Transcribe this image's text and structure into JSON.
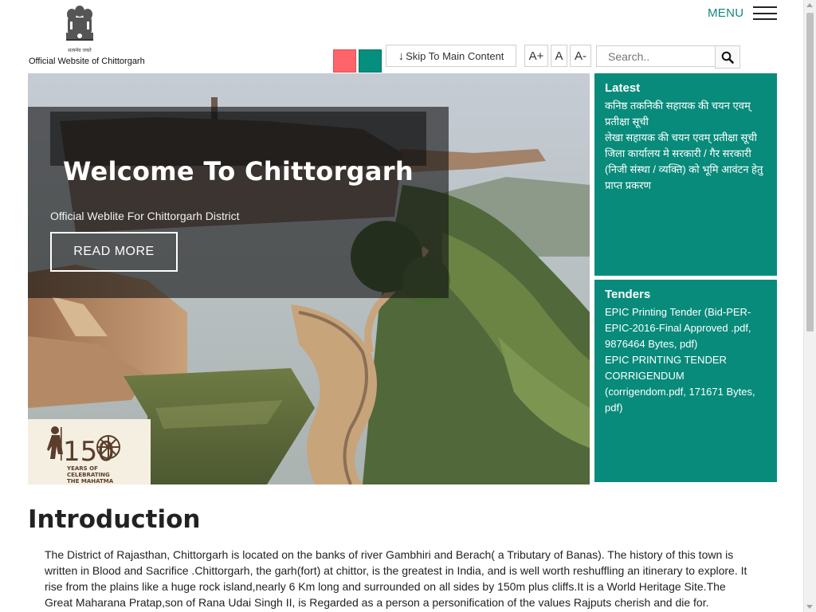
{
  "header": {
    "site_title": "Official Website of Chittorgarh",
    "emblem_caption": "सत्यमेव जयते",
    "menu_label": "MENU",
    "skip_link": "Skip To Main Content",
    "font_increase": "A+",
    "font_normal": "A",
    "font_decrease": "A-",
    "search_placeholder": "Search..",
    "theme_colors": [
      "#fd656a",
      "#058f7e"
    ]
  },
  "hero": {
    "title": "Welcome To Chittorgarh",
    "subtitle": "Official Weblite For Chittorgarh District",
    "button": "READ MORE",
    "badge_number": "150",
    "badge_line1": "YEARS OF",
    "badge_line2": "CELEBRATING",
    "badge_line3": "THE MAHATMA"
  },
  "latest": {
    "heading": "Latest",
    "items": [
      "कनिष्ठ तकनिकी सहायक की चयन एवम् प्रतीक्षा सूची",
      "लेखा सहायक की चयन एवम् प्रतीक्षा सूची",
      "जिला कार्यालय मे सरकारी / गैर सरकारी (निजी संस्था / व्यक्ति) को भूमि आवंटन हेतु प्राप्त प्रकरण"
    ]
  },
  "tenders": {
    "heading": "Tenders",
    "items": [
      "EPIC Printing Tender (Bid-PER-EPIC-2016-Final Approved .pdf, 9876464 Bytes, pdf)",
      "EPIC PRINTING TENDER CORRIGENDUM (corrigendom.pdf, 171671 Bytes, pdf)"
    ]
  },
  "intro": {
    "heading": "Introduction",
    "body": "The District of Rajasthan, Chittorgarh is located on the banks of river Gambhiri and Berach( a Tributary of Banas). The history of this town is written in Blood and Sacrifice .Chittorgarh, the garh(fort) at chittor, is the greatest in India, and is well worth reshuffling an itinerary to explore. It rise from the plains like a huge rock island,nearly 6 Km long and surrounded on all sides by 150m plus cliffs.It is a World Heritage Site.The Great Maharana Pratap,son of Rana Udai Singh II, is Regarded as a person a personification of the values Rajputs cherish and die for."
  },
  "colors": {
    "accent": "#088b7b",
    "menu_text": "#12897a"
  }
}
